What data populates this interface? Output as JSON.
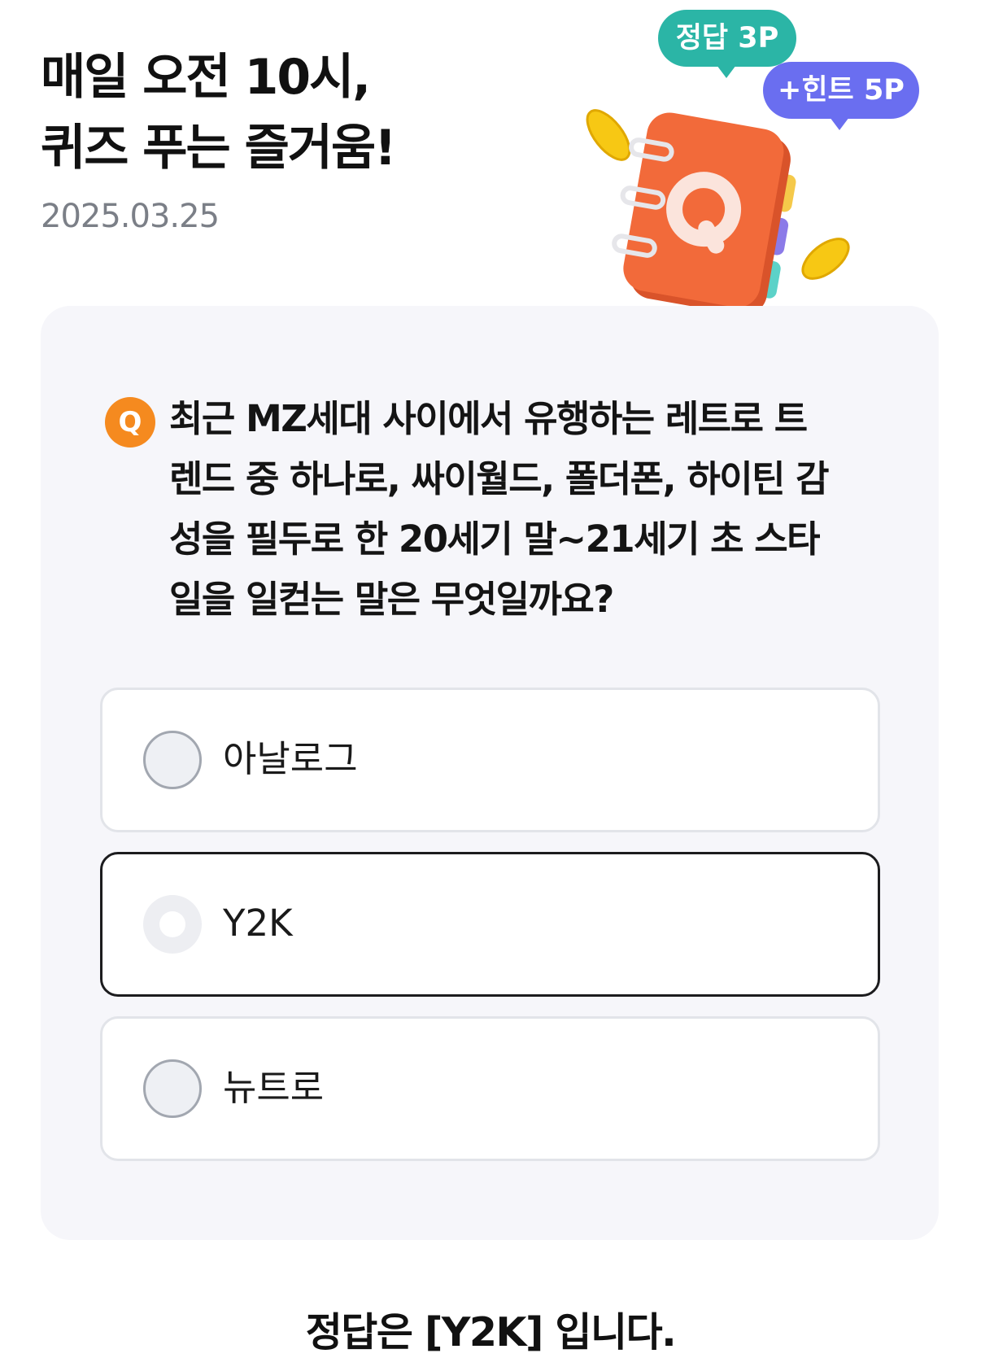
{
  "header": {
    "title_line1": "매일 오전 10시,",
    "title_line2": "퀴즈 푸는 즐거움!",
    "date": "2025.03.25"
  },
  "badges": {
    "answer_points": "정답 3P",
    "hint_points": "+힌트 5P"
  },
  "illustration": {
    "icon": "quiz-notebook-icon",
    "book_letter": "Q"
  },
  "quiz": {
    "q_marker": "Q",
    "question_lines": [
      "최근 MZ세대 사이에서 유행하는 레트로 트",
      "렌드 중 하나로, 싸이월드, 폴더폰, 하이틴 감",
      "성을 필두로 한 20세기 말~21세기 초 스타",
      "일을 일컫는 말은 무엇일까요?"
    ],
    "options": [
      {
        "label": "아날로그",
        "selected": false
      },
      {
        "label": "Y2K",
        "selected": true
      },
      {
        "label": "뉴트로",
        "selected": false
      }
    ]
  },
  "result": {
    "answer_text": "정답은 [Y2K] 입니다."
  },
  "colors": {
    "answer_badge": "#2bb5a6",
    "hint_badge": "#6a6ef0",
    "q_badge": "#f58a1f",
    "book": "#f26a3a",
    "card_bg": "#f6f6fa"
  }
}
